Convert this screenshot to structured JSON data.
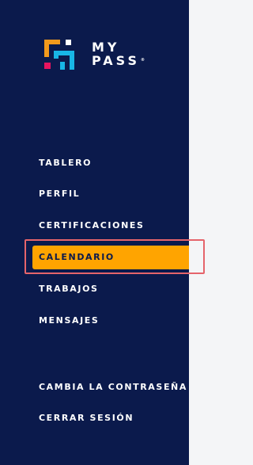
{
  "brand": {
    "line1": "MY",
    "line2": "PASS",
    "reg": "®"
  },
  "nav": {
    "items": [
      {
        "label": "TABLERO"
      },
      {
        "label": "PERFIL"
      },
      {
        "label": "CERTIFICACIONES"
      },
      {
        "label": "CALENDARIO",
        "active": true
      },
      {
        "label": "TRABAJOS"
      },
      {
        "label": "MENSAJES"
      }
    ],
    "account": [
      {
        "label": "CAMBIA LA CONTRASEÑA"
      },
      {
        "label": "CERRAR SESIÓN"
      }
    ]
  },
  "colors": {
    "sidebar_bg": "#0b1a4c",
    "active_bg": "#ffa400",
    "highlight_border": "#e5646b",
    "logo_orange": "#f39a1c",
    "logo_cyan": "#18b6e6",
    "logo_pink": "#e6145f"
  }
}
